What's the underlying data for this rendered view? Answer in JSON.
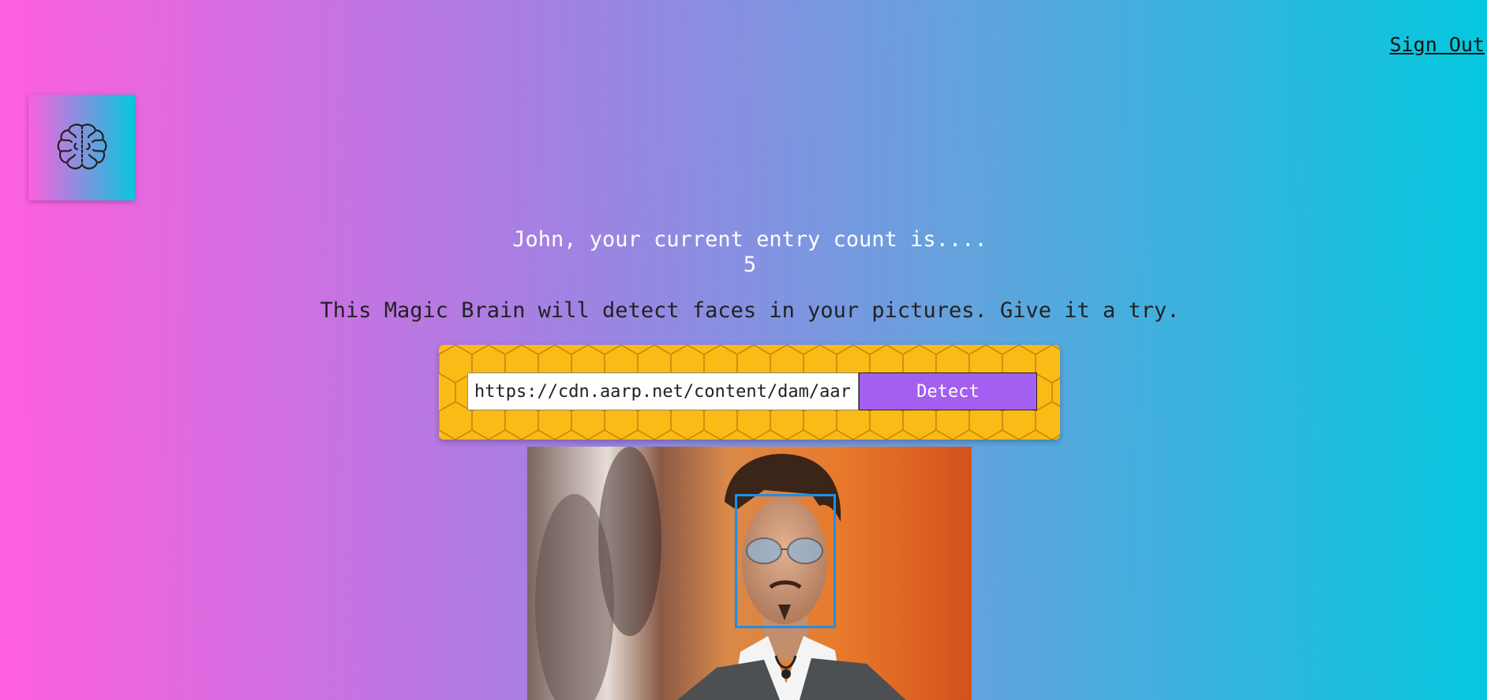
{
  "nav": {
    "signout_label": "Sign Out"
  },
  "logo": {
    "icon": "brain-icon"
  },
  "rank": {
    "message": "John, your current entry count is....",
    "count": "5"
  },
  "tagline": "This Magic Brain will detect faces in your pictures. Give it a try.",
  "form": {
    "url_value": "https://cdn.aarp.net/content/dam/aarp",
    "detect_label": "Detect"
  },
  "colors": {
    "gradient_start": "#ff5edf",
    "gradient_end": "#04c8de",
    "panel": "#fbbb16",
    "button": "#a25ff0",
    "face_box": "#1f8fe8"
  }
}
